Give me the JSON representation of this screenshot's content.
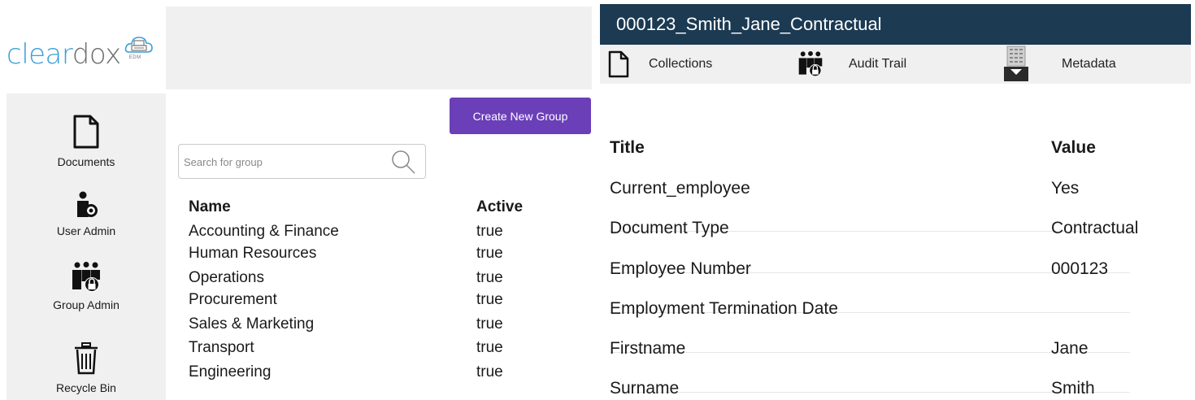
{
  "logo": {
    "part1": "clear",
    "part2": "dox",
    "badge": "EDM"
  },
  "sidebar": {
    "items": [
      {
        "label": "Documents",
        "icon": "document-icon"
      },
      {
        "label": "User Admin",
        "icon": "user-admin-icon"
      },
      {
        "label": "Group Admin",
        "icon": "group-admin-icon"
      },
      {
        "label": "Recycle Bin",
        "icon": "trash-icon"
      }
    ]
  },
  "groups": {
    "create_label": "Create New Group",
    "search_placeholder": "Search for group",
    "columns": {
      "name": "Name",
      "active": "Active"
    },
    "rows": [
      {
        "name": "Accounting & Finance",
        "active": "true"
      },
      {
        "name": "Human Resources",
        "active": "true"
      },
      {
        "name": "Operations",
        "active": "true"
      },
      {
        "name": "Procurement",
        "active": "true"
      },
      {
        "name": "Sales & Marketing",
        "active": "true"
      },
      {
        "name": "Transport",
        "active": "true"
      },
      {
        "name": "Engineering",
        "active": "true"
      }
    ]
  },
  "document": {
    "title": "000123_Smith_Jane_Contractual",
    "tabs": [
      {
        "label": "Collections",
        "icon": "document-icon"
      },
      {
        "label": "Audit Trail",
        "icon": "group-lock-icon"
      },
      {
        "label": "Metadata",
        "icon": "metadata-icon"
      }
    ],
    "metadata": {
      "columns": {
        "title": "Title",
        "value": "Value"
      },
      "rows": [
        {
          "title": "Current_employee",
          "value": "Yes"
        },
        {
          "title": "Document Type",
          "value": "Contractual"
        },
        {
          "title": "Employee Number",
          "value": "000123"
        },
        {
          "title": "Employment Termination Date",
          "value": ""
        },
        {
          "title": "Firstname",
          "value": "Jane"
        },
        {
          "title": "Surname",
          "value": "Smith"
        }
      ]
    }
  },
  "colors": {
    "accent_purple": "#6b3fb8",
    "title_bar": "#1c3a52",
    "logo_blue": "#3a9fd8",
    "panel_gray": "#f0f0f0"
  }
}
